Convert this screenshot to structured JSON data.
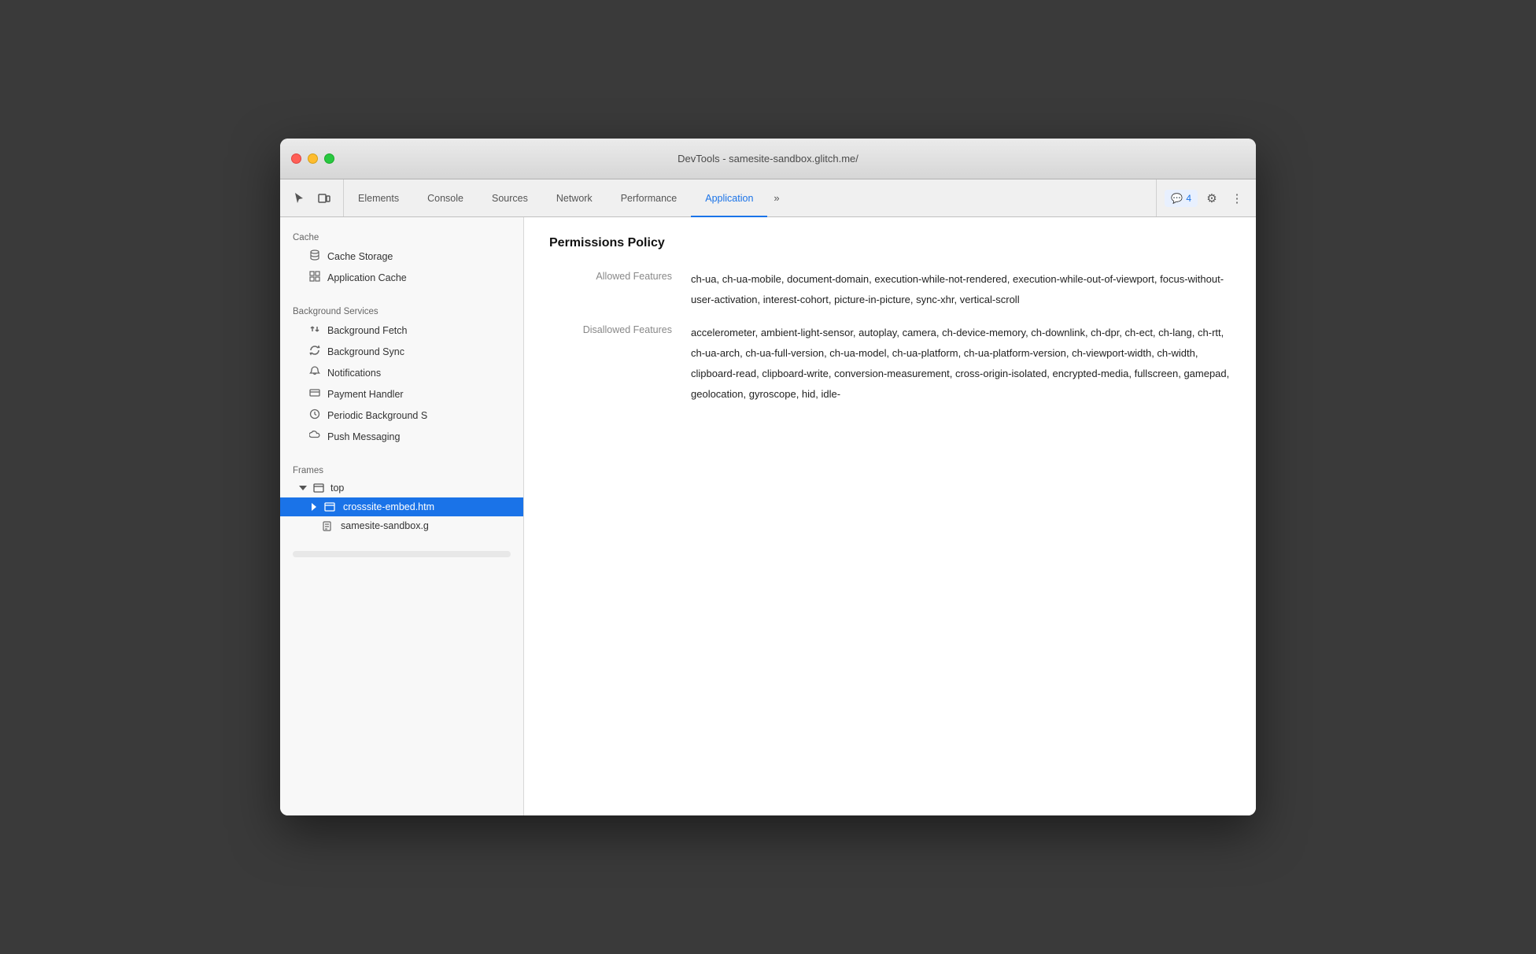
{
  "window": {
    "title": "DevTools - samesite-sandbox.glitch.me/"
  },
  "toolbar": {
    "tabs": [
      {
        "id": "elements",
        "label": "Elements",
        "active": false
      },
      {
        "id": "console",
        "label": "Console",
        "active": false
      },
      {
        "id": "sources",
        "label": "Sources",
        "active": false
      },
      {
        "id": "network",
        "label": "Network",
        "active": false
      },
      {
        "id": "performance",
        "label": "Performance",
        "active": false
      },
      {
        "id": "application",
        "label": "Application",
        "active": true
      }
    ],
    "more_label": "»",
    "badge_count": "4",
    "settings_label": "⚙",
    "more_options_label": "⋮"
  },
  "sidebar": {
    "cache_section": "Cache",
    "cache_items": [
      {
        "id": "cache-storage",
        "label": "Cache Storage",
        "icon": "🗄"
      },
      {
        "id": "application-cache",
        "label": "Application Cache",
        "icon": "▦"
      }
    ],
    "background_section": "Background Services",
    "background_items": [
      {
        "id": "background-fetch",
        "label": "Background Fetch",
        "icon": "↕"
      },
      {
        "id": "background-sync",
        "label": "Background Sync",
        "icon": "↻"
      },
      {
        "id": "notifications",
        "label": "Notifications",
        "icon": "🔔"
      },
      {
        "id": "payment-handler",
        "label": "Payment Handler",
        "icon": "🪪"
      },
      {
        "id": "periodic-background",
        "label": "Periodic Background S",
        "icon": "🕐"
      },
      {
        "id": "push-messaging",
        "label": "Push Messaging",
        "icon": "☁"
      }
    ],
    "frames_section": "Frames",
    "frames_top": "top",
    "frames_embed": "crosssite-embed.htm",
    "frames_sandbox": "samesite-sandbox.g"
  },
  "content": {
    "title": "Permissions Policy",
    "allowed_label": "Allowed Features",
    "allowed_value": "ch-ua, ch-ua-mobile, document-domain, execution-while-not-rendered, execution-while-out-of-viewport, focus-without-user-activation, interest-cohort, picture-in-picture, sync-xhr, vertical-scroll",
    "disallowed_label": "Disallowed Features",
    "disallowed_value": "accelerometer, ambient-light-sensor, autoplay, camera, ch-device-memory, ch-downlink, ch-dpr, ch-ect, ch-lang, ch-rtt, ch-ua-arch, ch-ua-full-version, ch-ua-model, ch-ua-platform, ch-ua-platform-version, ch-viewport-width, ch-width, clipboard-read, clipboard-write, conversion-measurement, cross-origin-isolated, encrypted-media, fullscreen, gamepad, geolocation, gyroscope, hid, idle-"
  }
}
